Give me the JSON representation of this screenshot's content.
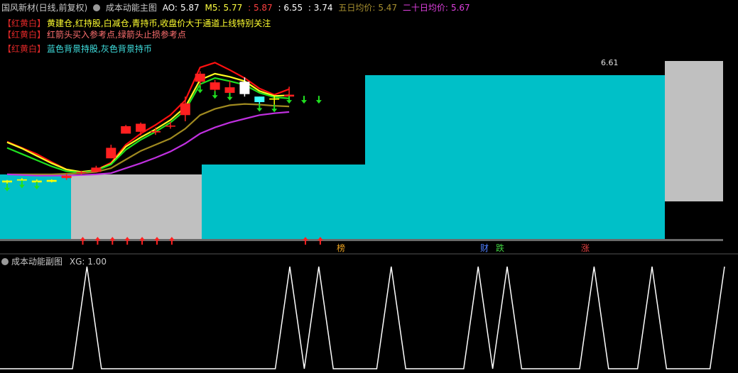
{
  "header": {
    "stock": "国风新材(日线,前复权)",
    "indicator": "成本动能主图",
    "ao_label": "AO:",
    "ao_value": "5.87",
    "m5_label": "M5:",
    "m5_value": "5.77",
    "v3": ": 5.87",
    "v4": ": 6.55",
    "v5": ": 3.74",
    "ma5_label": "五日均价:",
    "ma5_value": "5.47",
    "ma20_label": "二十日均价:",
    "ma20_value": "5.67"
  },
  "legend": [
    {
      "bracket": "【红黄白】",
      "text": "黄建仓,红持股,白减仓,青持币,收盘价大于通道上线特别关注",
      "color": "#ffff30"
    },
    {
      "bracket": "【红黄白】",
      "text": "红箭头买入参考点,绿箭头止损参考点",
      "color": "#ff7070"
    },
    {
      "bracket": "【红黄白】",
      "text": "蓝色背景持股,灰色背景持币",
      "color": "#40e0e0"
    }
  ],
  "price_label": "6.61",
  "markers": [
    {
      "text": "榜",
      "color": "#e8a020"
    },
    {
      "text": "财",
      "color": "#5080ff"
    },
    {
      "text": "跌",
      "color": "#40d040"
    },
    {
      "text": "涨",
      "color": "#e04040"
    }
  ],
  "sub": {
    "title": "成本动能副图",
    "xg_label": "XG:",
    "xg_value": "1.00"
  },
  "colors": {
    "cyan_band": "#00c0c8",
    "gray_band": "#c0c0c0",
    "rise": "#ff2020",
    "fall": "#ffffff",
    "hold_up": "#ffff00",
    "hold_down": "#40ffff",
    "line_red": "#ff1010",
    "line_yellow": "#ffff20",
    "line_green": "#20e020",
    "line_olive": "#a08a20",
    "line_purple": "#c030e0",
    "xg_line": "#ffffff"
  },
  "chart_data": [
    {
      "type": "candlestick",
      "title": "成本动能主图",
      "ylim": [
        3.74,
        6.61
      ],
      "candles": [
        {
          "o": 4.72,
          "c": 4.69,
          "h": 4.73,
          "l": 4.66,
          "cls": "hold_up"
        },
        {
          "o": 4.72,
          "c": 4.74,
          "h": 4.76,
          "l": 4.71,
          "cls": "hold_up"
        },
        {
          "o": 4.69,
          "c": 4.72,
          "h": 4.74,
          "l": 4.69,
          "cls": "hold_up"
        },
        {
          "o": 4.73,
          "c": 4.7,
          "h": 4.74,
          "l": 4.69,
          "cls": "hold_up"
        },
        {
          "o": 4.76,
          "c": 4.8,
          "h": 4.84,
          "l": 4.73,
          "cls": "rise"
        },
        {
          "o": 4.86,
          "c": 4.86,
          "h": 4.88,
          "l": 4.82,
          "cls": "rise"
        },
        {
          "o": 4.86,
          "c": 4.93,
          "h": 4.96,
          "l": 4.86,
          "cls": "rise"
        },
        {
          "o": 5.08,
          "c": 5.25,
          "h": 5.3,
          "l": 5.08,
          "cls": "rise"
        },
        {
          "o": 5.48,
          "c": 5.6,
          "h": 5.62,
          "l": 5.48,
          "cls": "rise"
        },
        {
          "o": 5.64,
          "c": 5.51,
          "h": 5.66,
          "l": 5.45,
          "cls": "rise"
        },
        {
          "o": 5.5,
          "c": 5.52,
          "h": 5.58,
          "l": 5.46,
          "cls": "rise"
        },
        {
          "o": 5.61,
          "c": 5.61,
          "h": 5.67,
          "l": 5.56,
          "cls": "rise"
        },
        {
          "o": 5.78,
          "c": 5.97,
          "h": 6.08,
          "l": 5.68,
          "cls": "rise"
        },
        {
          "o": 6.32,
          "c": 6.45,
          "h": 6.49,
          "l": 6.25,
          "cls": "rise"
        },
        {
          "o": 6.31,
          "c": 6.19,
          "h": 6.35,
          "l": 6.16,
          "cls": "rise"
        },
        {
          "o": 6.23,
          "c": 6.14,
          "h": 6.33,
          "l": 6.13,
          "cls": "rise"
        },
        {
          "o": 6.32,
          "c": 6.12,
          "h": 6.39,
          "l": 6.08,
          "cls": "fall"
        },
        {
          "o": 5.99,
          "c": 6.08,
          "h": 6.08,
          "l": 5.95,
          "cls": "hold_down"
        },
        {
          "o": 6.05,
          "c": 6.03,
          "h": 6.09,
          "l": 5.94,
          "cls": "hold_up"
        },
        {
          "o": 6.08,
          "c": 6.11,
          "h": 6.24,
          "l": 6.08,
          "cls": "rise"
        }
      ],
      "ma_lines": [
        {
          "name": "AO",
          "color": "line_red",
          "values": [
            5.35,
            5.25,
            5.15,
            5.02,
            4.9,
            4.85,
            4.89,
            5.01,
            5.3,
            5.48,
            5.62,
            5.78,
            6.02,
            6.55,
            6.63,
            6.51,
            6.38,
            6.21,
            6.11,
            6.2
          ]
        },
        {
          "name": "M5",
          "color": "line_yellow",
          "values": [
            5.34,
            5.24,
            5.12,
            5.0,
            4.9,
            4.86,
            4.89,
            4.99,
            5.27,
            5.42,
            5.55,
            5.7,
            5.91,
            6.35,
            6.45,
            6.4,
            6.33,
            6.17,
            6.09,
            6.1
          ]
        },
        {
          "name": "MA5",
          "color": "line_green",
          "values": [
            5.25,
            5.15,
            5.05,
            4.95,
            4.87,
            4.85,
            4.88,
            4.98,
            5.22,
            5.38,
            5.51,
            5.66,
            5.86,
            6.28,
            6.38,
            6.33,
            6.27,
            6.14,
            6.07,
            6.05
          ]
        },
        {
          "name": "MA20",
          "color": "line_olive",
          "values": [
            4.82,
            4.82,
            4.82,
            4.82,
            4.83,
            4.84,
            4.86,
            4.92,
            5.06,
            5.2,
            5.3,
            5.4,
            5.56,
            5.78,
            5.88,
            5.94,
            5.96,
            5.95,
            5.93,
            5.92
          ]
        },
        {
          "name": "MA60",
          "color": "line_purple",
          "values": [
            4.82,
            4.81,
            4.8,
            4.8,
            4.8,
            4.81,
            4.82,
            4.84,
            4.92,
            5.0,
            5.09,
            5.19,
            5.32,
            5.48,
            5.58,
            5.66,
            5.72,
            5.78,
            5.81,
            5.83
          ]
        }
      ],
      "buy_arrows": [
        5,
        6,
        7,
        8,
        9,
        10,
        11,
        20,
        21
      ],
      "stop_arrows": [
        0,
        1,
        2,
        13,
        14,
        15,
        17,
        18,
        19,
        20,
        21
      ],
      "xlabel": "",
      "ylabel": ""
    },
    {
      "type": "line",
      "title": "成本动能副图",
      "series": [
        {
          "name": "XG",
          "values": [
            0,
            0,
            0,
            0,
            0,
            0,
            1,
            0,
            0,
            0,
            0,
            0,
            0,
            0,
            0,
            0,
            0,
            0,
            0,
            0,
            1,
            0,
            1,
            0,
            0,
            0,
            0,
            1,
            0,
            0,
            0,
            0,
            0,
            1,
            0,
            1,
            0,
            0,
            0,
            0,
            0,
            1,
            0,
            0,
            0,
            1,
            0,
            0,
            0,
            0,
            1
          ]
        }
      ],
      "ylim": [
        0,
        1
      ]
    }
  ]
}
